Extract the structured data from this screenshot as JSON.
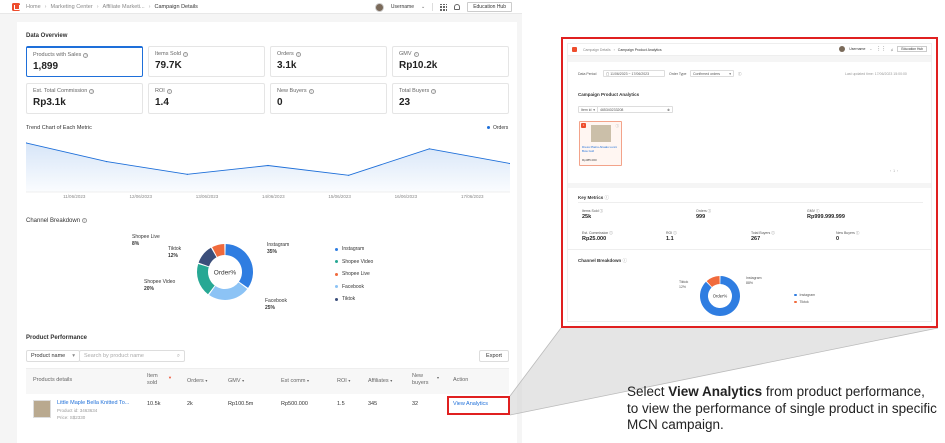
{
  "main": {
    "breadcrumbs": [
      "Home",
      "Marketing Center",
      "Affiliate Marketi...",
      "Campaign Details"
    ],
    "username": "Username",
    "education_hub": "Education Hub",
    "data_overview_title": "Data Overview",
    "metrics": [
      {
        "label": "Products with Sales",
        "value": "1,899"
      },
      {
        "label": "Items Sold",
        "value": "79.7K"
      },
      {
        "label": "Orders",
        "value": "3.1k"
      },
      {
        "label": "GMV",
        "value": "Rp10.2k"
      },
      {
        "label": "Est. Total Commission",
        "value": "Rp3.1k"
      },
      {
        "label": "ROI",
        "value": "1.4"
      },
      {
        "label": "New Buyers",
        "value": "0"
      },
      {
        "label": "Total Buyers",
        "value": "23"
      }
    ],
    "trend_title": "Trend Chart of Each Metric",
    "trend_legend": "Orders",
    "channel_title": "Channel Breakdown",
    "product_perf_title": "Product Performance",
    "product_select": "Product name",
    "search_placeholder": "Search by product name",
    "export_label": "Export",
    "table_headers": [
      "Products details",
      "Item sold",
      "Orders",
      "GMV",
      "Est comm",
      "ROI",
      "Affiliates",
      "New buyers",
      "Action"
    ],
    "row": {
      "name": "Little Maple Bella Knitted To...",
      "product_id": "Product id: 3463634",
      "price": "Price: S$2330",
      "item_sold": "10.5k",
      "orders": "2k",
      "gmv": "Rp100.5m",
      "est_comm": "Rp500.000",
      "roi": "1.5",
      "affiliates": "345",
      "new_buyers": "32",
      "action": "View Analytics"
    }
  },
  "inset": {
    "breadcrumb_title": "Campaign Product Analytics",
    "breadcrumb_prev": "Campaign Details",
    "username": "Username",
    "education_hub": "Education Hub",
    "data_period_label": "Data Period",
    "data_period_value": "11/06/2023 ~ 17/06/2023",
    "order_type_label": "Order Type",
    "order_type_value": "Confirmed orders",
    "last_updated": "Last updated time: 17/06/2023 15:00:00",
    "cpa_title": "Campaign Product Analytics",
    "item_id_select": "Item id",
    "item_id_value": "465340233208",
    "product_name": "Dress Plains Ahaalu Lunni Bow Goll",
    "product_price": "Rp385.000",
    "key_metrics_title": "Key Metrics",
    "key_metrics": [
      {
        "label": "Items Sold",
        "value": "25k"
      },
      {
        "label": "Orders",
        "value": "999"
      },
      {
        "label": "GMV",
        "value": "Rp999.999.999"
      },
      {
        "label": "Est. Commission",
        "value": "Rp25.000"
      },
      {
        "label": "ROI",
        "value": "1.1"
      },
      {
        "label": "Total Buyers",
        "value": "267"
      },
      {
        "label": "New Buyers",
        "value": "0"
      }
    ],
    "channel_title": "Channel Breakdown",
    "donut_center": "Order%"
  },
  "caption": {
    "prefix": "Select ",
    "bold": "View Analytics",
    "suffix": " from product performance, to view the performance of single product in specific MCN campaign."
  },
  "chart_data": [
    {
      "type": "line",
      "title": "Trend Chart of Each Metric",
      "x": [
        "11/06/2023",
        "12/06/2023",
        "13/06/2023",
        "14/06/2023",
        "15/06/2023",
        "16/06/2023",
        "17/06/2023"
      ],
      "series": [
        {
          "name": "Orders",
          "values": [
            100,
            62,
            36,
            54,
            34,
            88,
            58
          ]
        }
      ],
      "xlabel": "",
      "ylabel": "",
      "ylim": [
        0,
        110
      ],
      "grid": false,
      "legend": "top-right",
      "colors": [
        "#1e6fd9"
      ]
    },
    {
      "type": "pie",
      "title": "Channel Breakdown",
      "center_label": "Order%",
      "categories": [
        "Instagram",
        "Facebook",
        "Shopee Video",
        "Tiktok",
        "Shopee Live"
      ],
      "values": [
        35,
        25,
        20,
        12,
        8
      ],
      "legend_order": [
        "Instagram",
        "Shopee Video",
        "Shopee Live",
        "Facebook",
        "Tiktok"
      ],
      "colors": {
        "Instagram": "#2f7de1",
        "Facebook": "#8cc3f5",
        "Shopee Video": "#27a894",
        "Tiktok": "#3b4e7a",
        "Shopee Live": "#f06a3c"
      },
      "legend": "right"
    },
    {
      "type": "pie",
      "title": "Channel Breakdown",
      "center_label": "Order%",
      "categories": [
        "Instagram",
        "Tiktok"
      ],
      "values": [
        88,
        12
      ],
      "labels": {
        "Instagram": "88%",
        "Tiktok": "12%"
      },
      "colors": {
        "Instagram": "#2f7de1",
        "Tiktok": "#f06a3c"
      },
      "legend": "right"
    }
  ]
}
